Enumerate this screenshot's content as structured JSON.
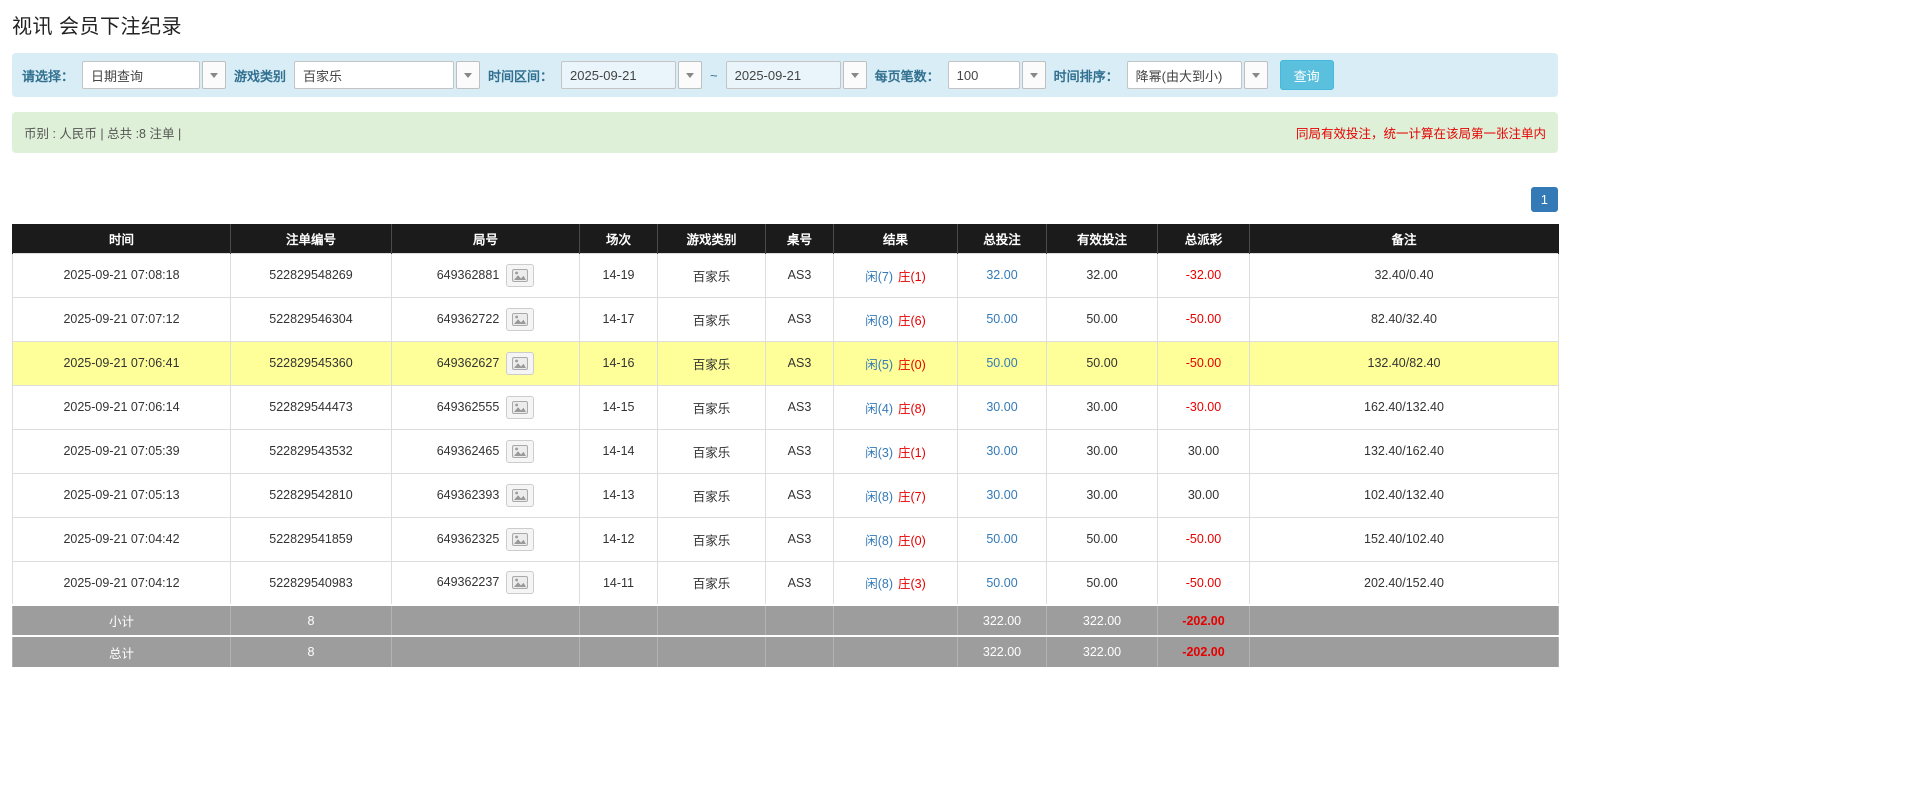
{
  "colors": {
    "filter_bar_bg": "#d9edf7",
    "filter_label": "#31708f",
    "info_bar_bg": "#dff0d8",
    "notice_red": "#e60000",
    "search_button_bg": "#5bc0de",
    "pagination_blue": "#337ab7",
    "table_header_bg": "#1b1b1b",
    "highlight_row": "#ffff99",
    "summary_row_bg": "#9d9d9d",
    "link_blue": "#337ab7",
    "negative_red": "#e60000"
  },
  "page": {
    "title": "视讯 会员下注纪录"
  },
  "filters": {
    "select_label": "请选择：",
    "select_value": "日期查询",
    "game_label": "游戏类别",
    "game_value": "百家乐",
    "range_label": "时间区间：",
    "date_from": "2025-09-21",
    "range_separator": "~",
    "date_to": "2025-09-21",
    "per_page_label": "每页笔数：",
    "per_page_value": "100",
    "sort_label": "时间排序：",
    "sort_value": "降幂(由大到小)",
    "search_button_label": "查询"
  },
  "info_bar": {
    "summary_text": "币别 : 人民币 | 总共 :8 注单 |",
    "notice_text": "同局有效投注，统一计算在该局第一张注单内"
  },
  "pagination": {
    "current_page": "1"
  },
  "table": {
    "headers": [
      "时间",
      "注单编号",
      "局号",
      "场次",
      "游戏类别",
      "桌号",
      "结果",
      "总投注",
      "有效投注",
      "总派彩",
      "备注"
    ],
    "rows": [
      {
        "time": "2025-09-21 07:08:18",
        "bet_id": "522829548269",
        "round_id": "649362881",
        "session": "14-19",
        "game": "百家乐",
        "table_no": "AS3",
        "player": "闲(7)",
        "banker": "庄(1)",
        "total_bet": "32.00",
        "valid_bet": "32.00",
        "payout": "-32.00",
        "note": "32.40/0.40",
        "highlight": false
      },
      {
        "time": "2025-09-21 07:07:12",
        "bet_id": "522829546304",
        "round_id": "649362722",
        "session": "14-17",
        "game": "百家乐",
        "table_no": "AS3",
        "player": "闲(8)",
        "banker": "庄(6)",
        "total_bet": "50.00",
        "valid_bet": "50.00",
        "payout": "-50.00",
        "note": "82.40/32.40",
        "highlight": false
      },
      {
        "time": "2025-09-21 07:06:41",
        "bet_id": "522829545360",
        "round_id": "649362627",
        "session": "14-16",
        "game": "百家乐",
        "table_no": "AS3",
        "player": "闲(5)",
        "banker": "庄(0)",
        "total_bet": "50.00",
        "valid_bet": "50.00",
        "payout": "-50.00",
        "note": "132.40/82.40",
        "highlight": true
      },
      {
        "time": "2025-09-21 07:06:14",
        "bet_id": "522829544473",
        "round_id": "649362555",
        "session": "14-15",
        "game": "百家乐",
        "table_no": "AS3",
        "player": "闲(4)",
        "banker": "庄(8)",
        "total_bet": "30.00",
        "valid_bet": "30.00",
        "payout": "-30.00",
        "note": "162.40/132.40",
        "highlight": false
      },
      {
        "time": "2025-09-21 07:05:39",
        "bet_id": "522829543532",
        "round_id": "649362465",
        "session": "14-14",
        "game": "百家乐",
        "table_no": "AS3",
        "player": "闲(3)",
        "banker": "庄(1)",
        "total_bet": "30.00",
        "valid_bet": "30.00",
        "payout": "30.00",
        "note": "132.40/162.40",
        "highlight": false
      },
      {
        "time": "2025-09-21 07:05:13",
        "bet_id": "522829542810",
        "round_id": "649362393",
        "session": "14-13",
        "game": "百家乐",
        "table_no": "AS3",
        "player": "闲(8)",
        "banker": "庄(7)",
        "total_bet": "30.00",
        "valid_bet": "30.00",
        "payout": "30.00",
        "note": "102.40/132.40",
        "highlight": false
      },
      {
        "time": "2025-09-21 07:04:42",
        "bet_id": "522829541859",
        "round_id": "649362325",
        "session": "14-12",
        "game": "百家乐",
        "table_no": "AS3",
        "player": "闲(8)",
        "banker": "庄(0)",
        "total_bet": "50.00",
        "valid_bet": "50.00",
        "payout": "-50.00",
        "note": "152.40/102.40",
        "highlight": false
      },
      {
        "time": "2025-09-21 07:04:12",
        "bet_id": "522829540983",
        "round_id": "649362237",
        "session": "14-11",
        "game": "百家乐",
        "table_no": "AS3",
        "player": "闲(8)",
        "banker": "庄(3)",
        "total_bet": "50.00",
        "valid_bet": "50.00",
        "payout": "-50.00",
        "note": "202.40/152.40",
        "highlight": false
      }
    ],
    "subtotal": {
      "label": "小计",
      "count": "8",
      "total_bet": "322.00",
      "valid_bet": "322.00",
      "payout": "-202.00"
    },
    "total": {
      "label": "总计",
      "count": "8",
      "total_bet": "322.00",
      "valid_bet": "322.00",
      "payout": "-202.00"
    }
  }
}
